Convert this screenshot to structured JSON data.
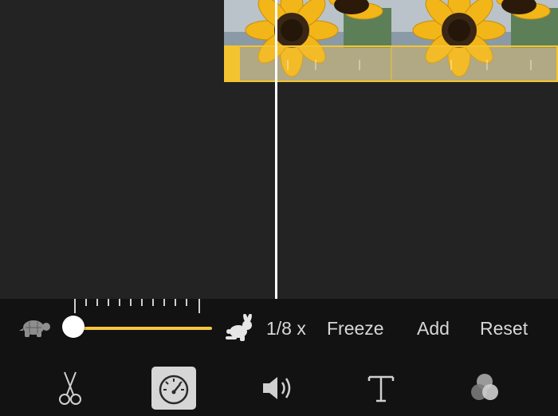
{
  "speed_controls": {
    "slow_icon": "turtle-icon",
    "fast_icon": "rabbit-icon",
    "speed_value": 0.125,
    "speed_label": "1/8 x",
    "freeze_label": "Freeze",
    "add_label": "Add",
    "reset_label": "Reset",
    "accent_color": "#f5c542"
  },
  "tools": [
    {
      "icon": "scissors-icon",
      "active": false
    },
    {
      "icon": "speedometer-icon",
      "active": true
    },
    {
      "icon": "speaker-icon",
      "active": false
    },
    {
      "icon": "text-icon",
      "active": false
    },
    {
      "icon": "filters-icon",
      "active": false
    }
  ]
}
